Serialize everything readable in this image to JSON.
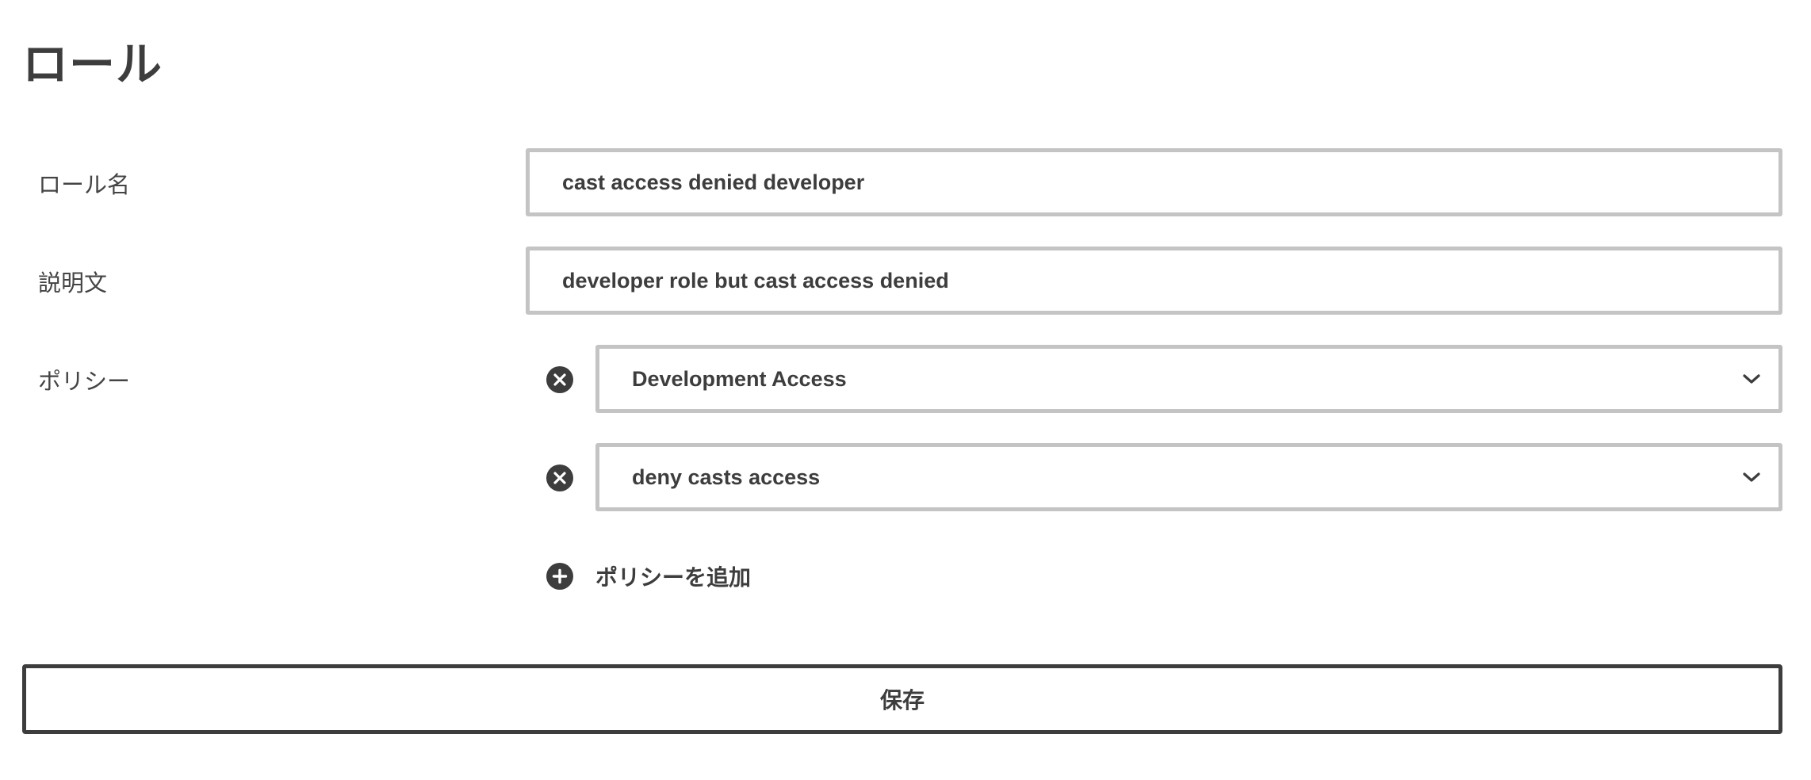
{
  "page": {
    "title": "ロール"
  },
  "form": {
    "role_name": {
      "label": "ロール名",
      "value": "cast access denied developer"
    },
    "description": {
      "label": "説明文",
      "value": "developer role but cast access denied"
    },
    "policies": {
      "label": "ポリシー",
      "items": [
        {
          "value": "Development Access",
          "remove_icon": "close-circle-icon",
          "dropdown_icon": "chevron-down-icon"
        },
        {
          "value": "deny casts access",
          "remove_icon": "close-circle-icon",
          "dropdown_icon": "chevron-down-icon"
        }
      ],
      "add_label": "ポリシーを追加",
      "add_icon": "plus-circle-icon"
    },
    "save_label": "保存"
  },
  "colors": {
    "text": "#3d3d3d",
    "input_border": "#c4c4c4",
    "button_border": "#3d3d3d",
    "background": "#ffffff"
  }
}
